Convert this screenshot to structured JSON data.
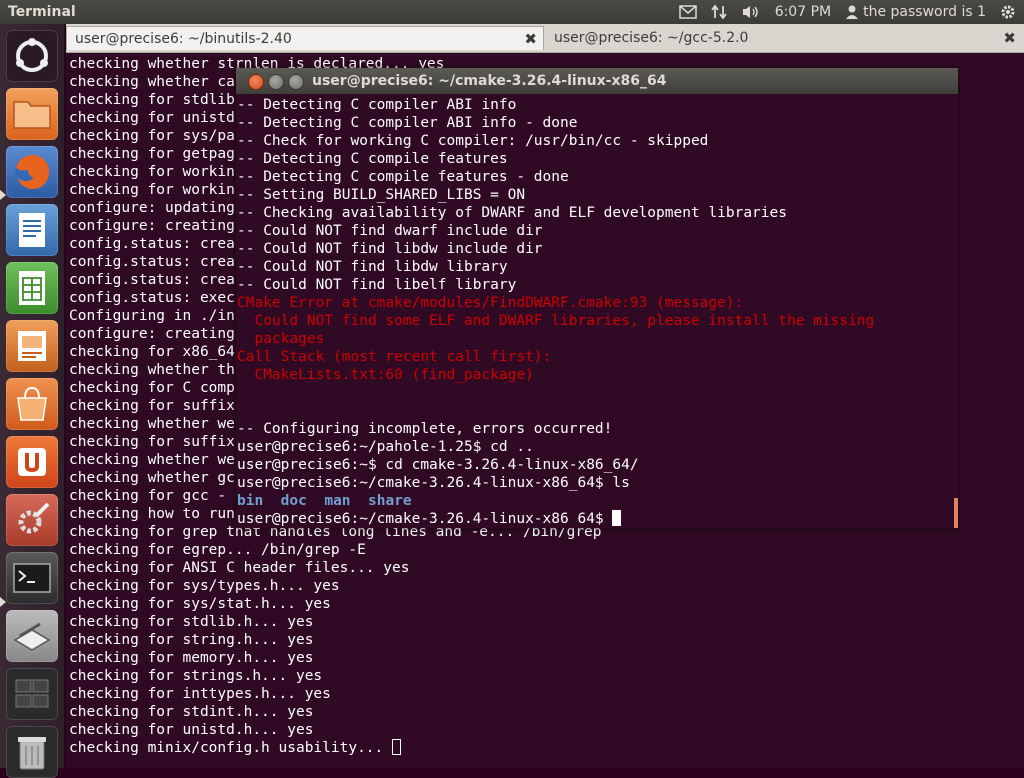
{
  "panel": {
    "app_title": "Terminal",
    "time": "6:07 PM",
    "user_label": "the password is 1",
    "icons": [
      "mail-icon",
      "network-icon",
      "volume-icon",
      "user-icon",
      "gear-icon"
    ]
  },
  "launcher": {
    "items": [
      "ubuntu-dash-icon",
      "files-icon",
      "firefox-icon",
      "writer-icon",
      "calc-icon",
      "impress-icon",
      "software-center-icon",
      "ubuntu-one-icon",
      "system-settings-icon",
      "terminal-icon",
      "scanner-icon",
      "workspace-switcher-icon",
      "trash-icon"
    ]
  },
  "tabs": [
    {
      "label": "user@precise6: ~/binutils-2.40",
      "close": "✖"
    },
    {
      "label": "user@precise6: ~/gcc-5.2.0",
      "close": "✖"
    }
  ],
  "main_terminal": {
    "lines": [
      "checking whether strnlen is declared... yes",
      "checking whether ca",
      "checking for stdlib",
      "checking for unistd",
      "checking for sys/pa",
      "checking for getpag",
      "checking for workin",
      "checking for workin",
      "configure: updating",
      "configure: creating",
      "config.status: crea",
      "config.status: crea",
      "config.status: crea",
      "config.status: exec",
      "Configuring in ./in",
      "configure: creating",
      "checking for x86_64",
      "checking whether th",
      "checking for C comp",
      "checking for suffix",
      "checking whether we",
      "checking for suffix",
      "checking whether we",
      "checking whether gc",
      "checking for gcc -",
      "checking how to run",
      "checking for grep that handles long lines and -e... /bin/grep",
      "checking for egrep... /bin/grep -E",
      "checking for ANSI C header files... yes",
      "checking for sys/types.h... yes",
      "checking for sys/stat.h... yes",
      "checking for stdlib.h... yes",
      "checking for string.h... yes",
      "checking for memory.h... yes",
      "checking for strings.h... yes",
      "checking for inttypes.h... yes",
      "checking for stdint.h... yes",
      "checking for unistd.h... yes",
      "checking minix/config.h usability... "
    ]
  },
  "float_window": {
    "title": "user@precise6: ~/cmake-3.26.4-linux-x86_64",
    "lines": [
      {
        "text": "-- Detecting C compiler ABI info",
        "style": "normal"
      },
      {
        "text": "-- Detecting C compiler ABI info - done",
        "style": "normal"
      },
      {
        "text": "-- Check for working C compiler: /usr/bin/cc - skipped",
        "style": "normal"
      },
      {
        "text": "-- Detecting C compile features",
        "style": "normal"
      },
      {
        "text": "-- Detecting C compile features - done",
        "style": "normal"
      },
      {
        "text": "-- Setting BUILD_SHARED_LIBS = ON",
        "style": "normal"
      },
      {
        "text": "-- Checking availability of DWARF and ELF development libraries",
        "style": "normal"
      },
      {
        "text": "-- Could NOT find dwarf include dir",
        "style": "normal"
      },
      {
        "text": "-- Could NOT find libdw include dir",
        "style": "normal"
      },
      {
        "text": "-- Could NOT find libdw library",
        "style": "normal"
      },
      {
        "text": "-- Could NOT find libelf library",
        "style": "normal"
      },
      {
        "text": "CMake Error at cmake/modules/FindDWARF.cmake:93 (message):",
        "style": "error"
      },
      {
        "text": "  Could NOT find some ELF and DWARF libraries, please install the missing",
        "style": "error"
      },
      {
        "text": "  packages",
        "style": "error"
      },
      {
        "text": "Call Stack (most recent call first):",
        "style": "error"
      },
      {
        "text": "  CMakeLists.txt:60 (find_package)",
        "style": "error"
      },
      {
        "text": "",
        "style": "normal"
      },
      {
        "text": "",
        "style": "normal"
      },
      {
        "text": "-- Configuring incomplete, errors occurred!",
        "style": "normal"
      },
      {
        "text": "user@precise6:~/pahole-1.25$ cd ..",
        "style": "normal"
      },
      {
        "text": "user@precise6:~$ cd cmake-3.26.4-linux-x86_64/",
        "style": "normal"
      },
      {
        "text": "user@precise6:~/cmake-3.26.4-linux-x86_64$ ls",
        "style": "normal"
      }
    ],
    "ls_output": [
      "bin",
      "doc",
      "man",
      "share"
    ],
    "prompt": "user@precise6:~/cmake-3.26.4-linux-x86_64$ "
  }
}
